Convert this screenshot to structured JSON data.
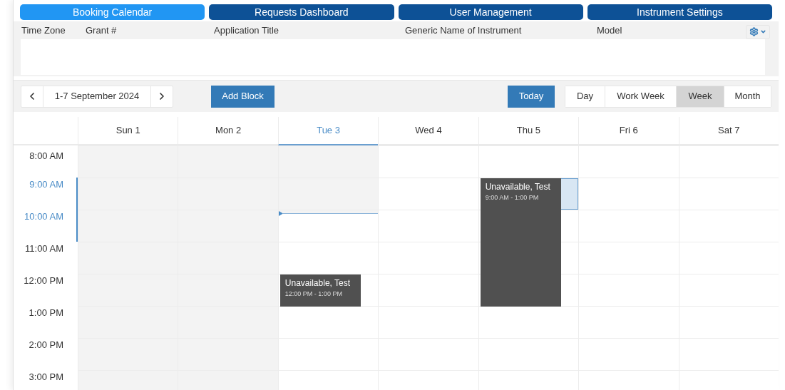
{
  "nav_tabs": [
    {
      "label": "Booking Calendar",
      "selected": true
    },
    {
      "label": "Requests Dashboard",
      "selected": false
    },
    {
      "label": "User Management",
      "selected": false
    },
    {
      "label": "Instrument Settings",
      "selected": false
    }
  ],
  "filter_table": {
    "columns": [
      "Time Zone",
      "Grant #",
      "Application Title",
      "Generic Name of Instrument",
      "Model"
    ]
  },
  "toolbar": {
    "date_range": "1-7 September 2024",
    "add_button": "Add Block",
    "today_button": "Today",
    "views": [
      {
        "label": "Day",
        "selected": false
      },
      {
        "label": "Work Week",
        "selected": false
      },
      {
        "label": "Week",
        "selected": true
      },
      {
        "label": "Month",
        "selected": false
      }
    ]
  },
  "calendar": {
    "hours": [
      {
        "label": "8:00 AM",
        "highlighted": false,
        "now_line": false
      },
      {
        "label": "9:00 AM",
        "highlighted": true,
        "now_line": false
      },
      {
        "label": "10:00 AM",
        "highlighted": true,
        "now_line": true
      },
      {
        "label": "11:00 AM",
        "highlighted": false,
        "now_line": false
      },
      {
        "label": "12:00 PM",
        "highlighted": false,
        "now_line": false
      },
      {
        "label": "1:00 PM",
        "highlighted": false,
        "now_line": false
      },
      {
        "label": "2:00 PM",
        "highlighted": false,
        "now_line": false
      },
      {
        "label": "3:00 PM",
        "highlighted": false,
        "now_line": false
      }
    ],
    "days": [
      {
        "label": "Sun 1",
        "selected": false,
        "slots": [
          {
            "kind": "past"
          },
          {
            "kind": "past"
          },
          {
            "kind": "past"
          },
          {
            "kind": "past"
          },
          {
            "kind": "past"
          },
          {
            "kind": "past"
          },
          {
            "kind": "past"
          },
          {
            "kind": "past"
          }
        ]
      },
      {
        "label": "Mon 2",
        "selected": false,
        "slots": [
          {
            "kind": "past"
          },
          {
            "kind": "past"
          },
          {
            "kind": "past"
          },
          {
            "kind": "past"
          },
          {
            "kind": "past"
          },
          {
            "kind": "past"
          },
          {
            "kind": "past"
          },
          {
            "kind": "past"
          }
        ]
      },
      {
        "label": "Tue 3",
        "selected": true,
        "slots": [
          {
            "kind": "past"
          },
          {
            "kind": "past"
          },
          {
            "kind": "free"
          },
          {
            "kind": "free"
          },
          {
            "kind": "busy"
          },
          {
            "kind": "free"
          },
          {
            "kind": "free"
          },
          {
            "kind": "free"
          }
        ],
        "events": [
          {
            "title": "Unavailable, Test",
            "time": "12:00 PM - 1:00 PM"
          }
        ]
      },
      {
        "label": "Wed 4",
        "selected": false,
        "slots": [
          {
            "kind": "free"
          },
          {
            "kind": "free"
          },
          {
            "kind": "free"
          },
          {
            "kind": "free"
          },
          {
            "kind": "free"
          },
          {
            "kind": "free"
          },
          {
            "kind": "free"
          },
          {
            "kind": "free"
          }
        ]
      },
      {
        "label": "Thu 5",
        "selected": false,
        "slots": [
          {
            "kind": "free"
          },
          {
            "kind": "busy-selected"
          },
          {
            "kind": "busy"
          },
          {
            "kind": "busy"
          },
          {
            "kind": "busy"
          },
          {
            "kind": "free"
          },
          {
            "kind": "free"
          },
          {
            "kind": "free"
          }
        ],
        "events": [
          {
            "title": "Unavailable, Test",
            "time": "9:00 AM - 1:00 PM"
          }
        ]
      },
      {
        "label": "Fri 6",
        "selected": false,
        "slots": [
          {
            "kind": "free"
          },
          {
            "kind": "free"
          },
          {
            "kind": "free"
          },
          {
            "kind": "free"
          },
          {
            "kind": "free"
          },
          {
            "kind": "free"
          },
          {
            "kind": "free"
          },
          {
            "kind": "free"
          }
        ]
      },
      {
        "label": "Sat 7",
        "selected": false,
        "slots": [
          {
            "kind": "free"
          },
          {
            "kind": "free"
          },
          {
            "kind": "free"
          },
          {
            "kind": "free"
          },
          {
            "kind": "free"
          },
          {
            "kind": "free"
          },
          {
            "kind": "free"
          },
          {
            "kind": "free"
          }
        ]
      }
    ]
  }
}
